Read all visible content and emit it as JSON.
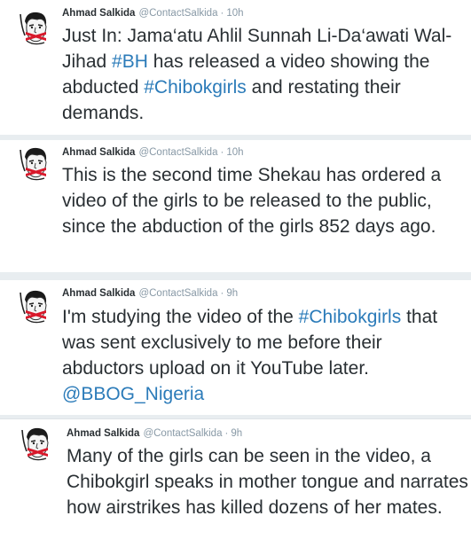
{
  "tweets": [
    {
      "name": "Ahmad Salkida",
      "handle": "@ContactSalkida",
      "sep": "·",
      "time": "10h",
      "segments": [
        {
          "t": "Just In: Jama‘atu Ahlil Sunnah Li-Da‘awati Wal-Jihad ",
          "link": false
        },
        {
          "t": "#BH",
          "link": true
        },
        {
          "t": " has released a video showing the abducted ",
          "link": false
        },
        {
          "t": "#Chibokgirls",
          "link": true
        },
        {
          "t": " and restating their demands.",
          "link": false
        }
      ]
    },
    {
      "name": "Ahmad Salkida",
      "handle": "@ContactSalkida",
      "sep": "·",
      "time": "10h",
      "segments": [
        {
          "t": "This is the second time Shekau has ordered a video of the girls to be released to the public, since the abduction of the girls 852 days ago.",
          "link": false
        }
      ]
    },
    {
      "name": "Ahmad Salkida",
      "handle": "@ContactSalkida",
      "sep": "·",
      "time": "9h",
      "segments": [
        {
          "t": "I'm studying the video of the ",
          "link": false
        },
        {
          "t": "#Chibokgirls",
          "link": true
        },
        {
          "t": " that was sent exclusively to me before their abductors upload on it YouTube later. ",
          "link": false
        },
        {
          "t": "@BBOG_Nigeria",
          "link": true
        }
      ]
    },
    {
      "name": "Ahmad Salkida",
      "handle": "@ContactSalkida",
      "sep": "·",
      "time": "9h",
      "segments": [
        {
          "t": "Many of the girls can be seen in the video, a Chibokgirl speaks in mother tongue and narrates how airstrikes has killed dozens of her mates.",
          "link": false
        }
      ]
    }
  ],
  "colors": {
    "link": "#2b7bb9",
    "text": "#292f33",
    "meta": "#8899a6",
    "gag": "#d8182a"
  }
}
